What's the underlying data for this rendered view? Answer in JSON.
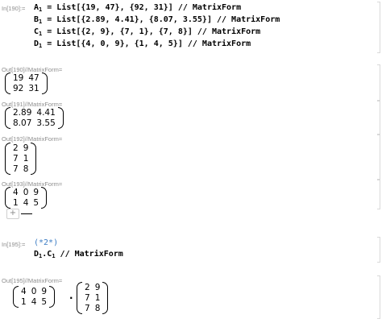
{
  "in190": {
    "label": "In[190]:=",
    "lines": [
      {
        "name": "A",
        "sub": "1",
        "rest": " = List[{19, 47}, {92, 31}] // MatrixForm"
      },
      {
        "name": "B",
        "sub": "1",
        "rest": " = List[{2.89, 4.41}, {8.07, 3.55}] // MatrixForm"
      },
      {
        "name": "C",
        "sub": "1",
        "rest": " = List[{2, 9}, {7, 1}, {7, 8}] // MatrixForm"
      },
      {
        "name": "D",
        "sub": "1",
        "rest": " = List[{4, 0, 9}, {1, 4, 5}] // MatrixForm"
      }
    ]
  },
  "outputs": [
    {
      "label": "Out[190]//MatrixForm=",
      "rows": [
        [
          "19",
          "47"
        ],
        [
          "92",
          "31"
        ]
      ]
    },
    {
      "label": "Out[191]//MatrixForm=",
      "rows": [
        [
          "2.89",
          "4.41"
        ],
        [
          "8.07",
          "3.55"
        ]
      ]
    },
    {
      "label": "Out[192]//MatrixForm=",
      "rows": [
        [
          "2",
          "9"
        ],
        [
          "7",
          "1"
        ],
        [
          "7",
          "8"
        ]
      ]
    },
    {
      "label": "Out[193]//MatrixForm=",
      "rows": [
        [
          "4",
          "0",
          "9"
        ],
        [
          "1",
          "4",
          "5"
        ]
      ]
    }
  ],
  "in195": {
    "label": "In[195]:=",
    "comment": "(*2*)",
    "line": {
      "a": "D",
      "a_sub": "1",
      "op": ".",
      "b": "C",
      "b_sub": "1",
      "rest": " // MatrixForm"
    }
  },
  "out195": {
    "label": "Out[195]//MatrixForm=",
    "left_rows": [
      [
        "4",
        "0",
        "9"
      ],
      [
        "1",
        "4",
        "5"
      ]
    ],
    "dot": ".",
    "right_rows": [
      [
        "2",
        "9"
      ],
      [
        "7",
        "1"
      ],
      [
        "7",
        "8"
      ]
    ]
  },
  "insert_cell_icon": "+"
}
